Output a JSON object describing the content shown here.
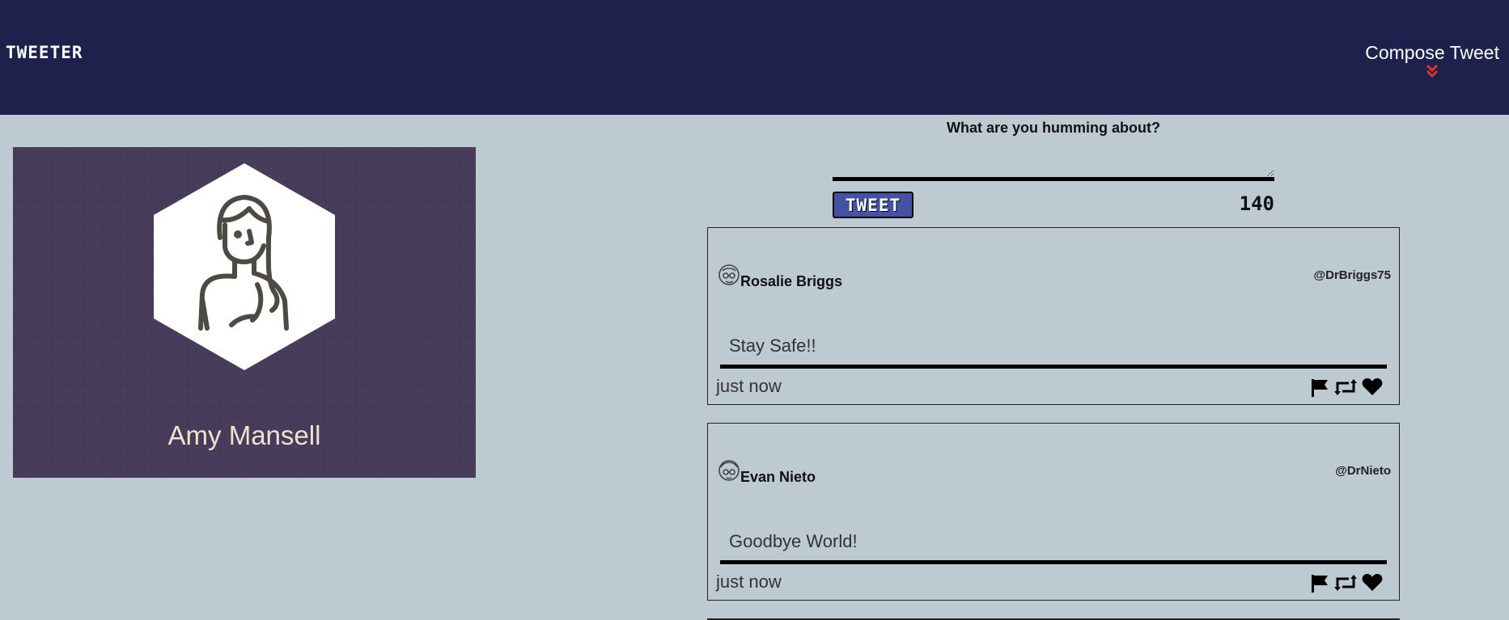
{
  "nav": {
    "brand": "TWEETER",
    "compose_label": "Compose Tweet"
  },
  "profile": {
    "name": "Amy Mansell",
    "avatar_icon": "woman-avatar-icon"
  },
  "new_tweet": {
    "heading": "What are you humming about?",
    "textarea_value": "",
    "button_label": "TWEET",
    "counter": "140"
  },
  "tweets": [
    {
      "name": "Rosalie Briggs",
      "handle": "@DrBriggs75",
      "text": "Stay Safe!!",
      "time": "just now",
      "avatar_icon": "user-avatar-icon"
    },
    {
      "name": "Evan Nieto",
      "handle": "@DrNieto",
      "text": "Goodbye World!",
      "time": "just now",
      "avatar_icon": "user-avatar-icon"
    }
  ],
  "colors": {
    "navbar": "#1d224c",
    "background": "#bdcad2",
    "profile_bg": "#4a3f5e",
    "accent_red": "#e0322d",
    "tweet_button": "#4452a3"
  }
}
